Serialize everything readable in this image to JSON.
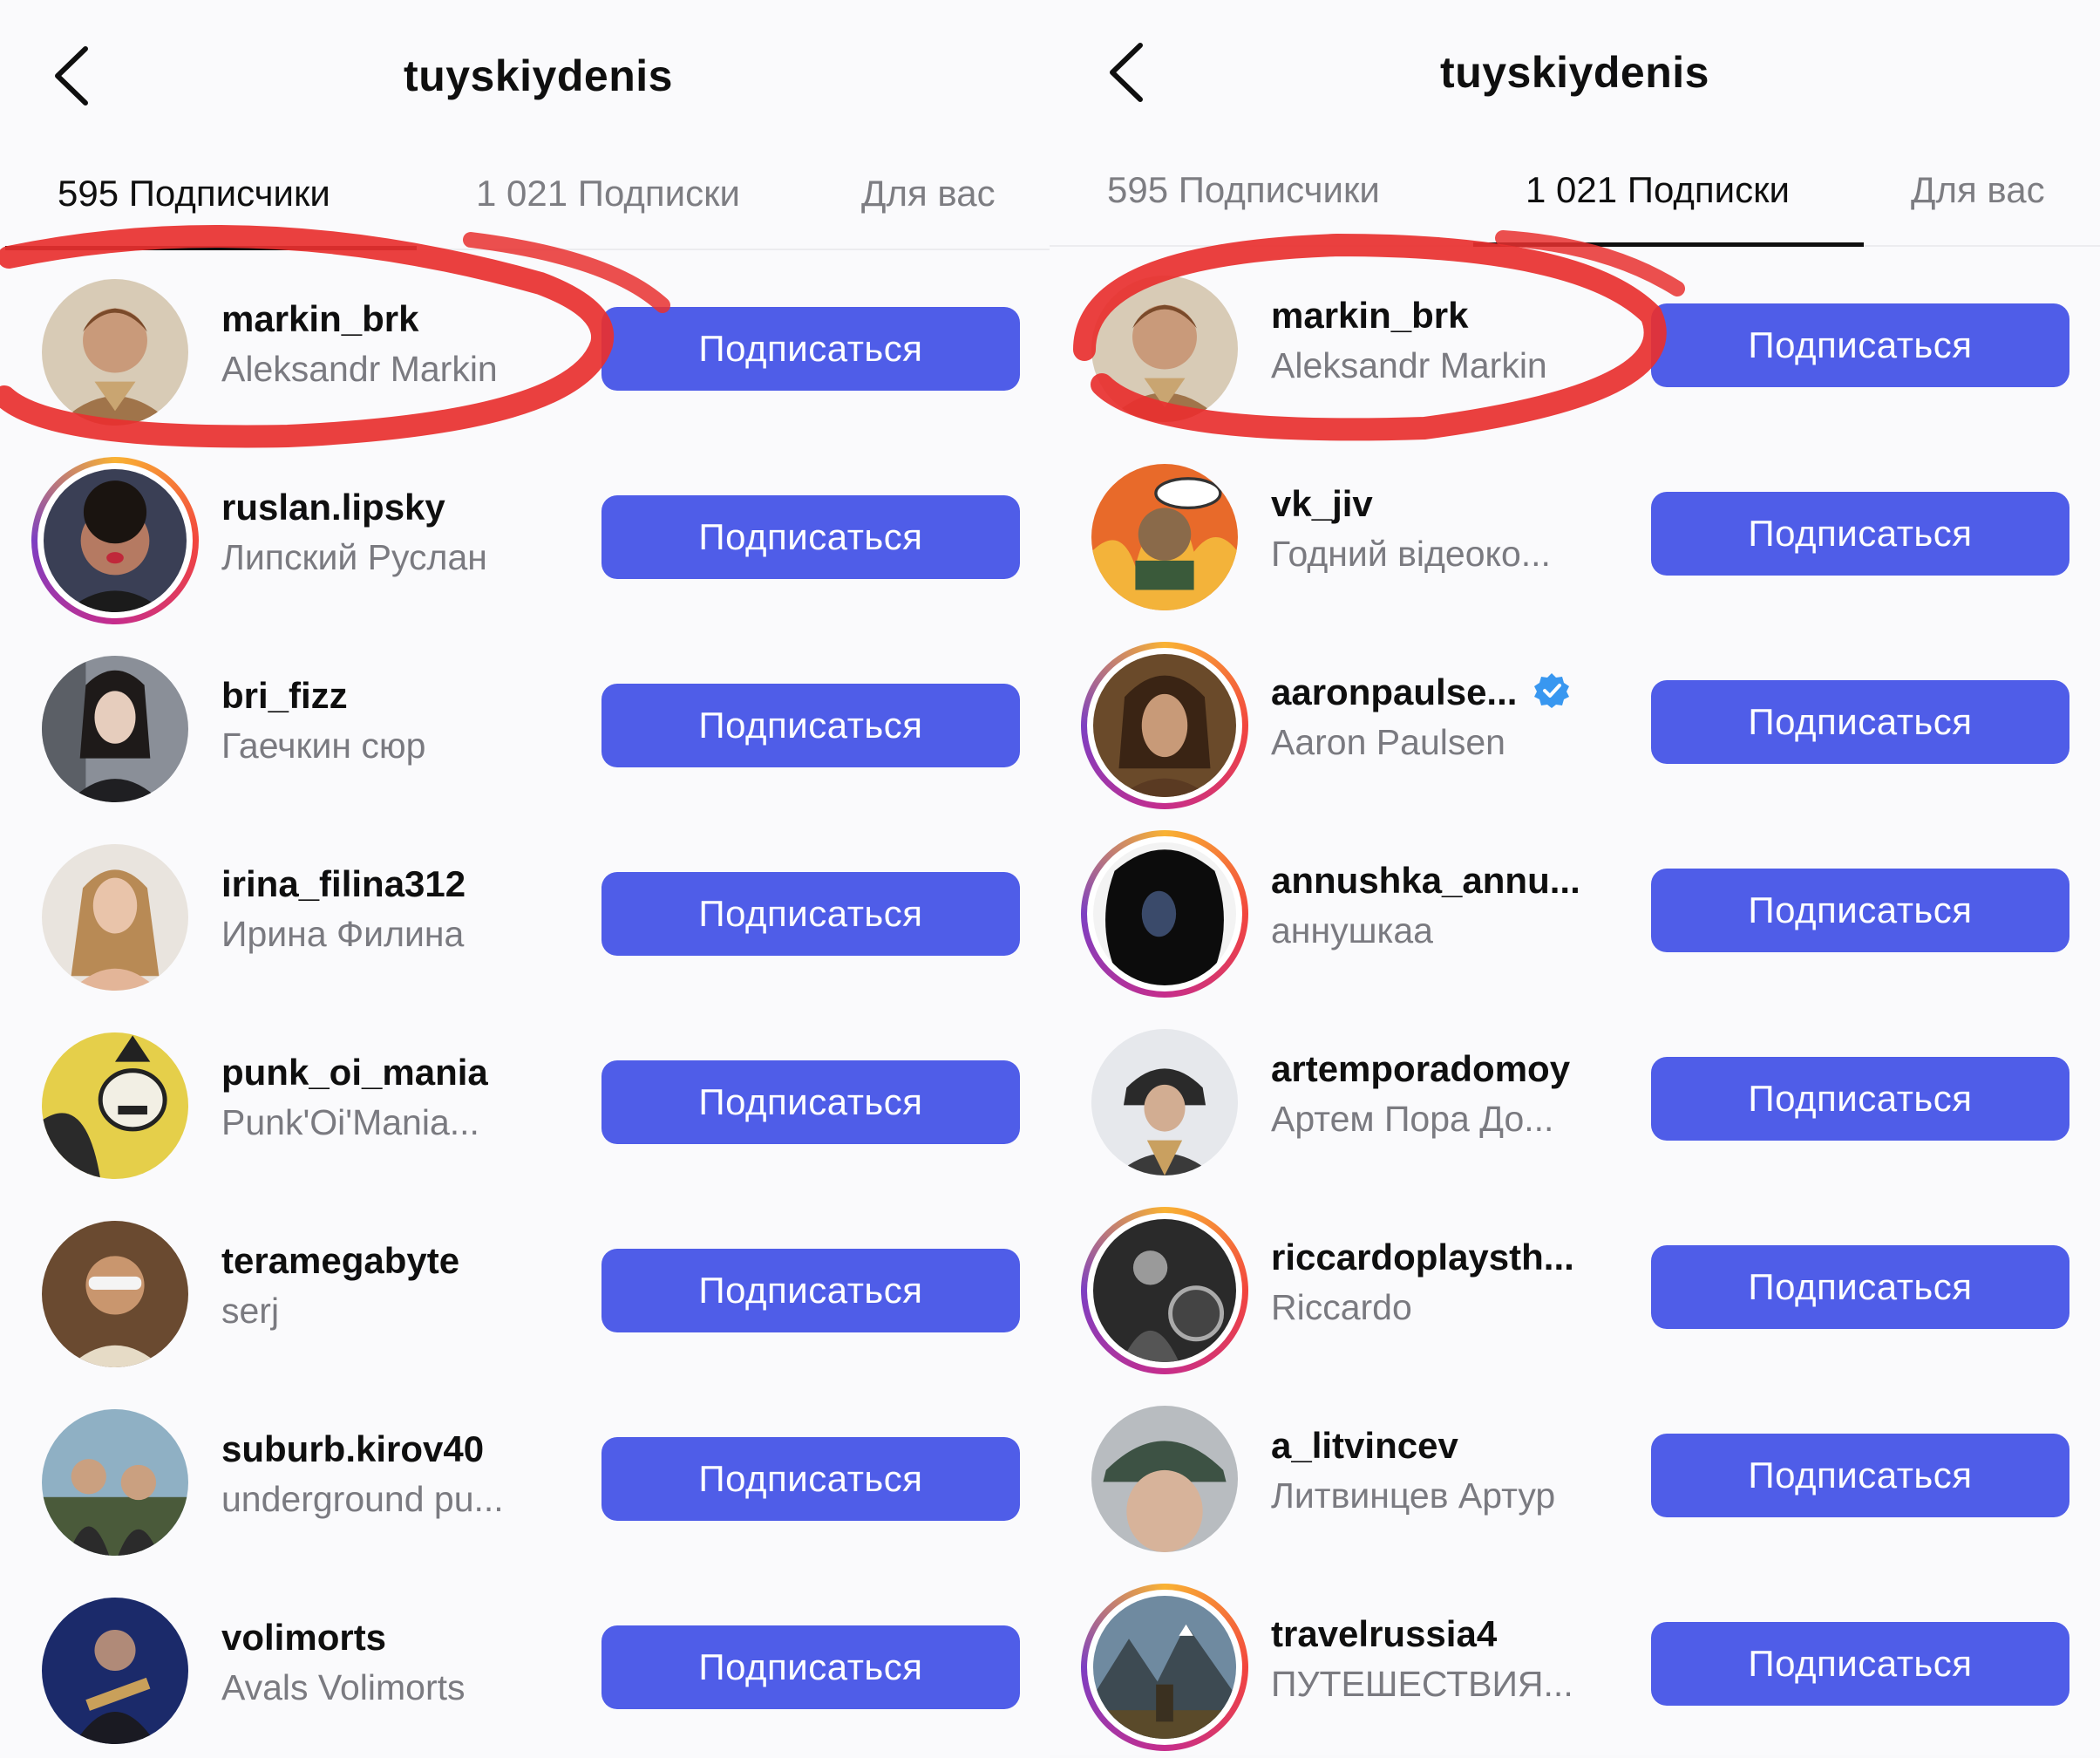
{
  "left": {
    "title": "tuyskiydenis",
    "tabs": [
      {
        "label": "595 Подписчики",
        "active": true
      },
      {
        "label": "1 021 Подписки",
        "active": false
      },
      {
        "label": "Для вас",
        "active": false
      }
    ],
    "follow_label": "Подписаться",
    "users": [
      {
        "username": "markin_brk",
        "fullname": "Aleksandr Markin",
        "story_ring": false,
        "verified": false,
        "highlighted": true
      },
      {
        "username": "ruslan.lipsky",
        "fullname": "Липский Руслан",
        "story_ring": true,
        "verified": false
      },
      {
        "username": "bri_fizz",
        "fullname": "Гаечкин сюр",
        "story_ring": false,
        "verified": false
      },
      {
        "username": "irina_filina312",
        "fullname": "Ирина Филина",
        "story_ring": false,
        "verified": false
      },
      {
        "username": "punk_oi_mania",
        "fullname": "Punk'Oi'Mania...",
        "story_ring": false,
        "verified": false
      },
      {
        "username": "teramegabyte",
        "fullname": "serj",
        "story_ring": false,
        "verified": false
      },
      {
        "username": "suburb.kirov40",
        "fullname": "underground pu...",
        "story_ring": false,
        "verified": false
      },
      {
        "username": "volimorts",
        "fullname": "Avals Volimorts",
        "story_ring": false,
        "verified": false
      }
    ]
  },
  "right": {
    "title": "tuyskiydenis",
    "tabs": [
      {
        "label": "595 Подписчики",
        "active": false
      },
      {
        "label": "1 021 Подписки",
        "active": true
      },
      {
        "label": "Для вас",
        "active": false
      }
    ],
    "follow_label": "Подписаться",
    "users": [
      {
        "username": "markin_brk",
        "fullname": "Aleksandr Markin",
        "story_ring": false,
        "verified": false,
        "highlighted": true
      },
      {
        "username": "vk_jiv",
        "fullname": "Годний відеоко...",
        "story_ring": false,
        "verified": false
      },
      {
        "username": "aaronpaulse...",
        "fullname": "Aaron Paulsen",
        "story_ring": true,
        "verified": true
      },
      {
        "username": "annushka_annu...",
        "fullname": "аннушкаа",
        "story_ring": true,
        "verified": false
      },
      {
        "username": "artemporadomoy",
        "fullname": "Артем Пора До...",
        "story_ring": false,
        "verified": false
      },
      {
        "username": "riccardoplaysth...",
        "fullname": "Riccardo",
        "story_ring": true,
        "verified": false
      },
      {
        "username": "a_litvincev",
        "fullname": "Литвинцев Артур",
        "story_ring": false,
        "verified": false
      },
      {
        "username": "travelrussia4",
        "fullname": "ПУТЕШЕСТВИЯ...",
        "story_ring": true,
        "verified": false
      }
    ]
  },
  "colors": {
    "follow_button": "#4f5de8",
    "annotation_red": "#e8302f",
    "verified_blue": "#3897f0"
  },
  "icons": {
    "back": "chevron-left-icon",
    "verified": "verified-badge-icon"
  }
}
